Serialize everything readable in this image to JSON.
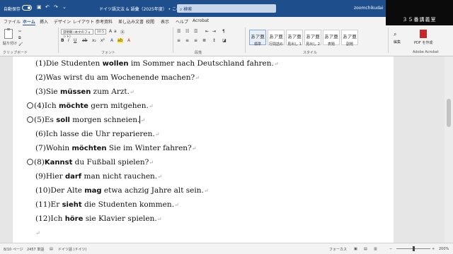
{
  "titlebar": {
    "autosave_label": "自動保存",
    "toggle_state": "オフ",
    "doc_title": "ドイツ語文法 & 語彙（2025年度） • この PC に保存済み",
    "search_placeholder": "検索",
    "user": "zoomchikudai",
    "camera_label": "３５番講義室"
  },
  "tabs": [
    "ファイル",
    "ホーム",
    "挿入",
    "デザイン",
    "レイアウト",
    "参考資料",
    "差し込み文書",
    "校閲",
    "表示",
    "ヘルプ",
    "Acrobat"
  ],
  "ribbon": {
    "paste_label": "貼り付け",
    "font_name": "游明朝 (本文のフォント)",
    "font_size": "10.5",
    "clipboard_label": "クリップボード",
    "font_label": "フォント",
    "paragraph_label": "段落",
    "styles_label": "スタイル",
    "edit_label": "編集",
    "acrobat_label": "Adobe Acrobat",
    "pdf_label": "PDF を作成",
    "styles": [
      {
        "sample": "あア亜",
        "name": "標準"
      },
      {
        "sample": "あア亜",
        "name": "行間詰め"
      },
      {
        "sample": "あア亜",
        "name": "見出し 1"
      },
      {
        "sample": "あア亜",
        "name": "見出し 2"
      },
      {
        "sample": "あア亜",
        "name": "表題"
      },
      {
        "sample": "あア亜",
        "name": "副題"
      }
    ]
  },
  "document": {
    "lines": [
      {
        "pre": "(1)Die Studenten ",
        "bold": "wollen",
        "post": " im Sommer nach Deutschland fahren."
      },
      {
        "pre": "(2)Was wirst du am Wochenende machen?",
        "bold": "",
        "post": ""
      },
      {
        "pre": "(3)Sie ",
        "bold": "müssen",
        "post": " zum Arzt."
      },
      {
        "pre": "(4)Ich ",
        "bold": "möchte",
        "post": " gern mitgehen."
      },
      {
        "pre": "(5)Es ",
        "bold": "soll",
        "post": " morgen schneien."
      },
      {
        "pre": "(6)Ich lasse die Uhr reparieren.",
        "bold": "",
        "post": ""
      },
      {
        "pre": "(7)Wohin ",
        "bold": "möchten",
        "post": " Sie im Winter fahren?"
      },
      {
        "pre": "(8)",
        "bold": "Kannst",
        "post": " du Fußball spielen?"
      },
      {
        "pre": "(9)Hier ",
        "bold": "darf",
        "post": " man nicht rauchen."
      },
      {
        "pre": "(10)Der Alte ",
        "bold": "mag",
        "post": " etwa achzig Jahre alt sein."
      },
      {
        "pre": "(11)Er ",
        "bold": "sieht",
        "post": " die Studenten kommen."
      },
      {
        "pre": "(12)Ich ",
        "bold": "höre",
        "post": " sie Klavier spielen."
      }
    ]
  },
  "statusbar": {
    "page": "8/10 ページ",
    "words": "2457 単語",
    "language": "ドイツ語 (ドイツ)",
    "focus": "フォーカス",
    "zoom": "200%"
  }
}
